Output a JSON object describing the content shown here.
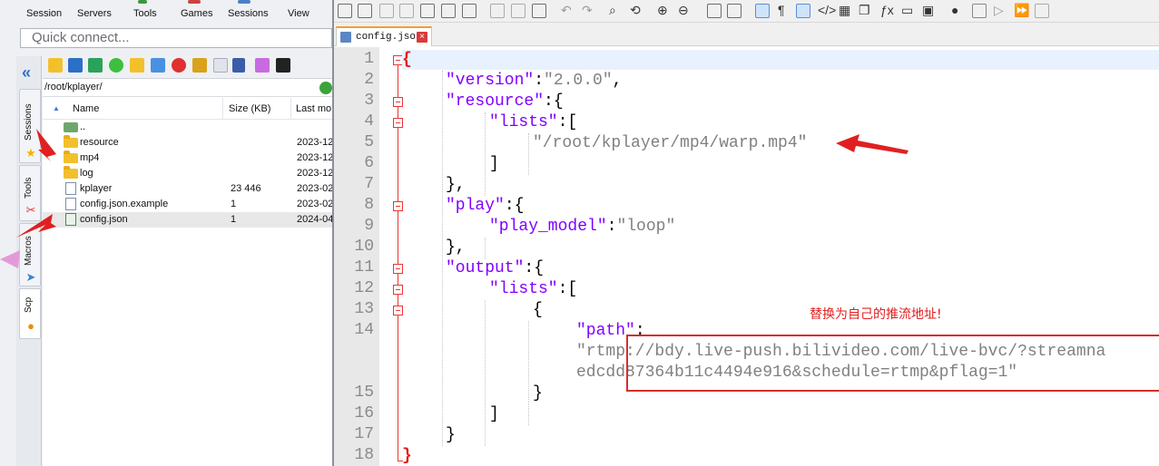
{
  "menubar": {
    "items": [
      "Session",
      "Servers",
      "Tools",
      "Games",
      "Sessions",
      "View"
    ]
  },
  "quick_connect": {
    "placeholder": "Quick connect..."
  },
  "side_tabs": [
    "Sessions",
    "Tools",
    "Macros",
    "Scp"
  ],
  "file_panel": {
    "path": "/root/kplayer/",
    "columns": {
      "name": "Name",
      "size": "Size (KB)",
      "modified": "Last mo"
    },
    "rows": [
      {
        "name": "..",
        "size": "",
        "modified": "",
        "type": "up"
      },
      {
        "name": "resource",
        "size": "",
        "modified": "2023-12",
        "type": "folder"
      },
      {
        "name": "mp4",
        "size": "",
        "modified": "2023-12",
        "type": "folder"
      },
      {
        "name": "log",
        "size": "",
        "modified": "2023-12",
        "type": "folder"
      },
      {
        "name": "kplayer",
        "size": "23 446",
        "modified": "2023-02",
        "type": "file"
      },
      {
        "name": "config.json.example",
        "size": "1",
        "modified": "2023-02",
        "type": "file"
      },
      {
        "name": "config.json",
        "size": "1",
        "modified": "2024-04",
        "type": "file-edit"
      }
    ]
  },
  "editor": {
    "tab_label": "config.json",
    "line_numbers": [
      "1",
      "2",
      "3",
      "4",
      "5",
      "6",
      "7",
      "8",
      "9",
      "10",
      "11",
      "12",
      "13",
      "14",
      "15",
      "16",
      "17",
      "18"
    ],
    "code": {
      "l1": "{",
      "l2_key": "\"version\"",
      "l2_colon": ":",
      "l2_val": "\"2.0.0\"",
      "l2_end": ",",
      "l3_key": "\"resource\"",
      "l3_rest": ":{",
      "l4_key": "\"lists\"",
      "l4_rest": ":[",
      "l5_val": "\"/root/kplayer/mp4/warp.mp4\"",
      "l6": "]",
      "l7": "},",
      "l8_key": "\"play\"",
      "l8_rest": ":{",
      "l9_key": "\"play_model\"",
      "l9_colon": ":",
      "l9_val": "\"loop\"",
      "l10": "},",
      "l11_key": "\"output\"",
      "l11_rest": ":{",
      "l12_key": "\"lists\"",
      "l12_rest": ":[",
      "l13": "{",
      "l14_key": "\"path\"",
      "l14_colon": ":",
      "l14_val1": "\"rtmp://bdy.live-push.bilivideo.com/live-bvc/?streamna",
      "l14_val2": "edcdd87364b11c4494e916&schedule=rtmp&pflag=1\"",
      "l15": "}",
      "l16": "]",
      "l17": "}",
      "l18": "}"
    },
    "annotation": "替换为自己的推流地址!"
  }
}
